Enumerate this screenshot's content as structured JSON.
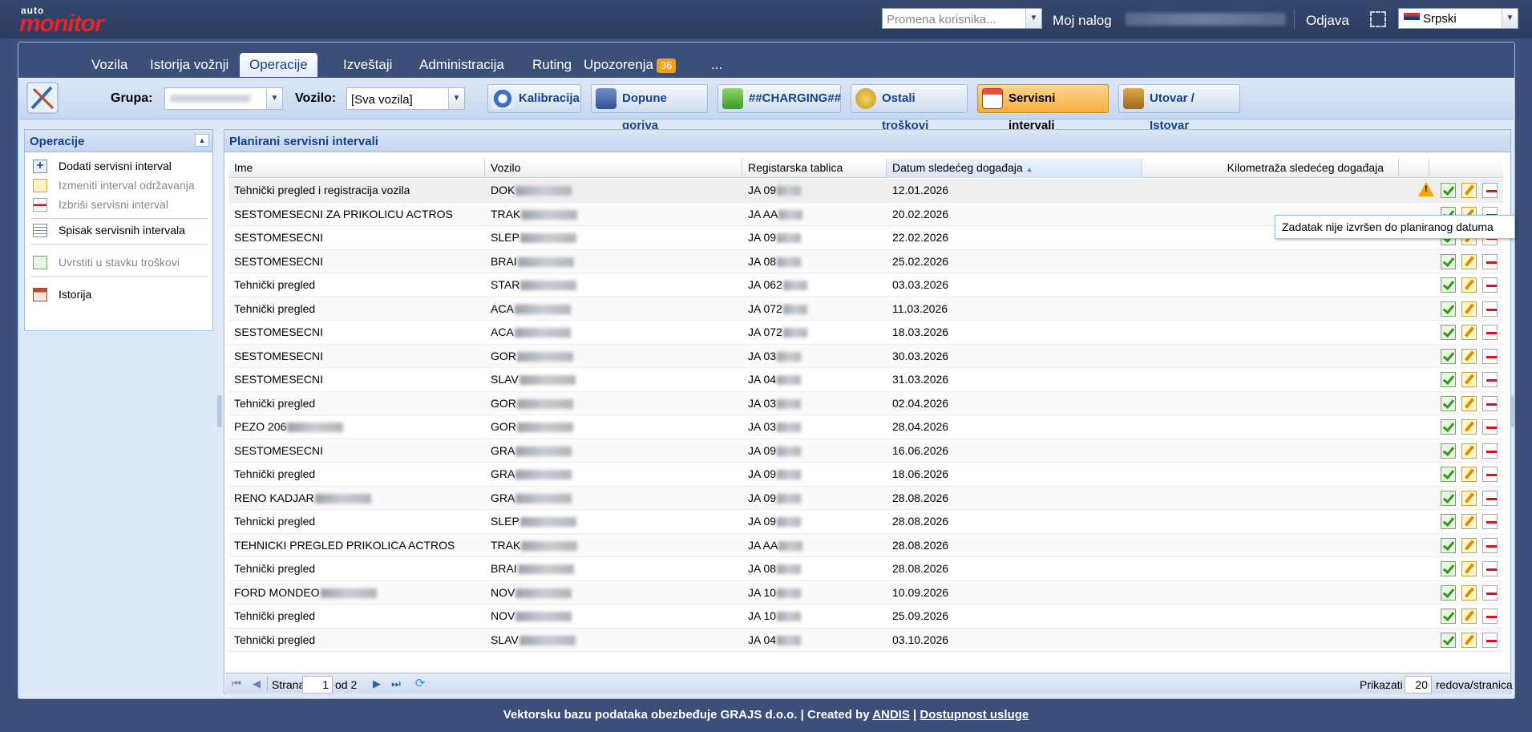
{
  "app": {
    "logo_small": "auto",
    "logo_big": "monitor"
  },
  "topbar": {
    "user_select_placeholder": "Promena korisnika...",
    "my_account": "Moj nalog",
    "logout": "Odjava",
    "language": "Srpski"
  },
  "tabs": [
    {
      "label": "Vozila"
    },
    {
      "label": "Istorija vožnji"
    },
    {
      "label": "Operacije"
    },
    {
      "label": "Izveštaji"
    },
    {
      "label": "Administracija"
    },
    {
      "label": "Ruting"
    },
    {
      "label": "Upozorenja",
      "badge": "36"
    },
    {
      "label": "..."
    }
  ],
  "toolbar": {
    "group_label": "Grupa:",
    "vehicle_label": "Vozilo:",
    "vehicle_value": "[Sva vozila]",
    "buttons": [
      {
        "label": "Kalibracija"
      },
      {
        "label": "Dopune goriva"
      },
      {
        "label": "##CHARGING##"
      },
      {
        "label": "Ostali troškovi"
      },
      {
        "label": "Servisni intervali"
      },
      {
        "label": "Utovar / Istovar"
      }
    ]
  },
  "leftpanel": {
    "title": "Operacije",
    "items": [
      {
        "label": "Dodati servisni interval"
      },
      {
        "label": "Izmeniti interval održavanja"
      },
      {
        "label": "Izbriši servisni interval"
      },
      {
        "label": "Spisak servisnih intervala"
      },
      {
        "label": "Uvrstiti u stavku troškovi"
      },
      {
        "label": "Istorija"
      }
    ]
  },
  "grid": {
    "title": "Planirani servisni intervali",
    "columns": [
      "Ime",
      "Vozilo",
      "Registarska tablica",
      "Datum sledećeg događaja",
      "Kilometraža sledećeg događaja"
    ],
    "rows": [
      {
        "name": "Tehnički pregled i registracija vozila",
        "vehicle": "DOK",
        "plate": "JA 09",
        "date": "12.01.2026"
      },
      {
        "name": "SESTOMESECNI ZA PRIKOLICU ACTROS",
        "vehicle": "TRAK",
        "plate": "JA AA",
        "date": "20.02.2026"
      },
      {
        "name": "SESTOMESECNI",
        "vehicle": "SLEP",
        "plate": "JA 09",
        "date": "22.02.2026"
      },
      {
        "name": "SESTOMESECNI",
        "vehicle": "BRAI",
        "plate": "JA 08",
        "date": "25.02.2026"
      },
      {
        "name": "Tehnički pregled",
        "vehicle": "STAR",
        "plate": "JA 062",
        "date": "03.03.2026"
      },
      {
        "name": "Tehnički pregled",
        "vehicle": "ACA",
        "plate": "JA 072",
        "date": "11.03.2026"
      },
      {
        "name": "SESTOMESECNI",
        "vehicle": "ACA",
        "plate": "JA 072",
        "date": "18.03.2026"
      },
      {
        "name": "SESTOMESECNI",
        "vehicle": "GOR",
        "plate": "JA 03",
        "date": "30.03.2026"
      },
      {
        "name": "SESTOMESECNI",
        "vehicle": "SLAV",
        "plate": "JA 04",
        "date": "31.03.2026"
      },
      {
        "name": "Tehnički pregled",
        "vehicle": "GOR",
        "plate": "JA 03",
        "date": "02.04.2026"
      },
      {
        "name": "PEZO 206",
        "vehicle": "GOR",
        "plate": "JA 03",
        "date": "28.04.2026"
      },
      {
        "name": "SESTOMESECNI",
        "vehicle": "GRA",
        "plate": "JA 09",
        "date": "16.06.2026"
      },
      {
        "name": "Tehnički pregled",
        "vehicle": "GRA",
        "plate": "JA 09",
        "date": "18.06.2026"
      },
      {
        "name": "RENO KADJAR",
        "vehicle": "GRA",
        "plate": "JA 09",
        "date": "28.08.2026"
      },
      {
        "name": "Tehnicki pregled",
        "vehicle": "SLEP",
        "plate": "JA 09",
        "date": "28.08.2026"
      },
      {
        "name": "TEHNICKI PREGLED PRIKOLICA ACTROS",
        "vehicle": "TRAK",
        "plate": "JA AA",
        "date": "28.08.2026"
      },
      {
        "name": "Tehnički pregled",
        "vehicle": "BRAI",
        "plate": "JA 08",
        "date": "28.08.2026"
      },
      {
        "name": "FORD MONDEO",
        "vehicle": "NOV",
        "plate": "JA 10",
        "date": "10.09.2026"
      },
      {
        "name": "Tehnički pregled",
        "vehicle": "NOV",
        "plate": "JA 10",
        "date": "25.09.2026"
      },
      {
        "name": "Tehnički pregled",
        "vehicle": "SLAV",
        "plate": "JA 04",
        "date": "03.10.2026"
      }
    ],
    "tooltip": "Zadatak nije izvršen do planiranog datuma"
  },
  "pager": {
    "page_label": "Strana",
    "page": "1",
    "of_label": "od 2",
    "show_label": "Prikazati",
    "per_page": "20",
    "per_page_suffix": "redova/stranica"
  },
  "footer": {
    "text": "Vektorsku bazu podataka obezbeđuje GRAJS d.o.o.  | Created by ",
    "andis": "ANDIS",
    "sep": " | ",
    "availability": "Dostupnost usluge"
  }
}
